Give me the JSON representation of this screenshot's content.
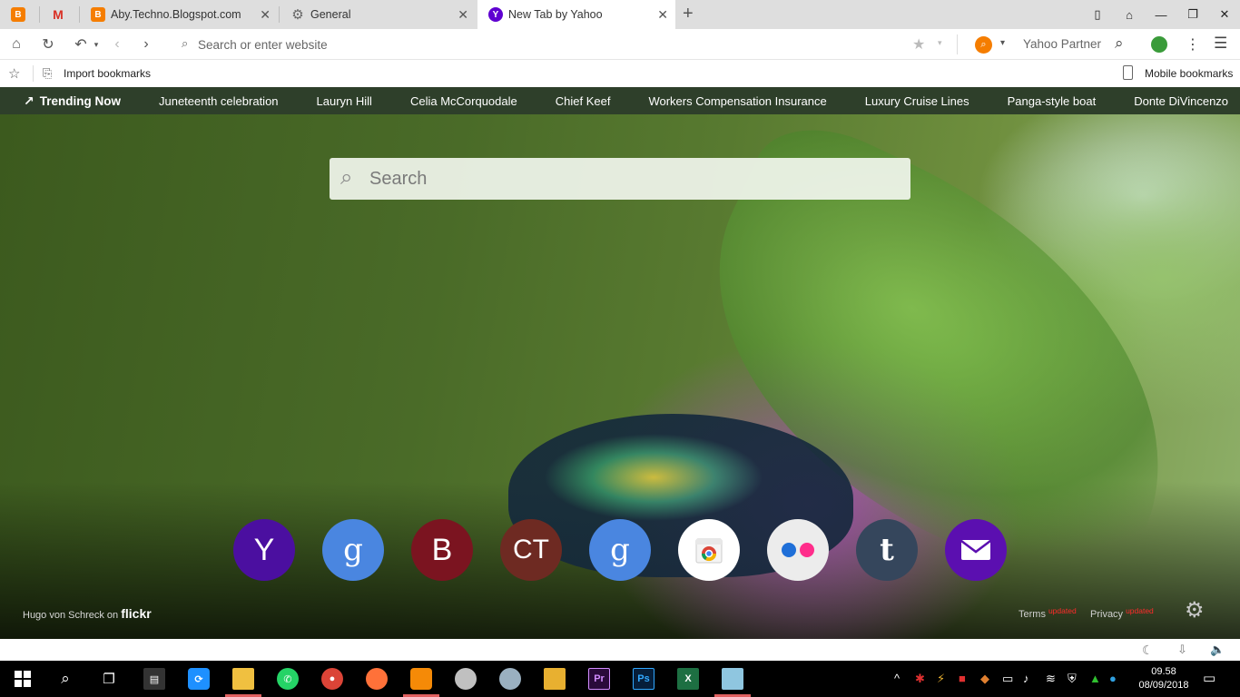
{
  "tabs": [
    {
      "label": "",
      "icon": "blogger-icon",
      "color": "#f57d00"
    },
    {
      "label": "",
      "icon": "gmail-icon",
      "color": "#d93025"
    },
    {
      "label": "Aby.Techno.Blogspot.com",
      "icon": "blogger-icon",
      "color": "#f57d00"
    },
    {
      "label": "General",
      "icon": "gear-icon",
      "color": "#666666"
    },
    {
      "label": "New Tab by Yahoo",
      "icon": "yahoo-icon",
      "color": "#5f01d1"
    }
  ],
  "addressbar": {
    "placeholder": "Search or enter website",
    "search_engine_label": "Yahoo Partner"
  },
  "bookmarks": {
    "import_label": "Import bookmarks",
    "mobile_label": "Mobile bookmarks"
  },
  "trending": {
    "title": "Trending Now",
    "items": [
      "Juneteenth celebration",
      "Lauryn Hill",
      "Celia McCorquodale",
      "Chief Keef",
      "Workers Compensation Insurance",
      "Luxury Cruise Lines",
      "Panga-style boat",
      "Donte DiVincenzo"
    ]
  },
  "search": {
    "placeholder": "Search"
  },
  "tiles": [
    {
      "label": "Y",
      "name": "yahoo-tile",
      "color": "#4b0fa0"
    },
    {
      "label": "g",
      "name": "google-tile",
      "color": "#4a86e0"
    },
    {
      "label": "B",
      "name": "b-tile",
      "color": "#7b1420"
    },
    {
      "label": "CT",
      "name": "ct-tile",
      "color": "#6e2a22"
    },
    {
      "label": "g",
      "name": "google-tile-2",
      "color": "#4a86e0"
    },
    {
      "label": "",
      "name": "chrome-store-tile",
      "color": "#ffffff"
    },
    {
      "label": "",
      "name": "flickr-tile",
      "color": "#ececec"
    },
    {
      "label": "t",
      "name": "tumblr-tile",
      "color": "#35465c"
    },
    {
      "label": "",
      "name": "mail-tile",
      "color": "#5b0fb0"
    }
  ],
  "credit": {
    "text": "Hugo von Schreck on",
    "brand": "flickr"
  },
  "footer": {
    "terms": "Terms",
    "privacy": "Privacy",
    "updated": "updated"
  },
  "taskbar": {
    "time": "09.58",
    "date": "08/09/2018"
  }
}
